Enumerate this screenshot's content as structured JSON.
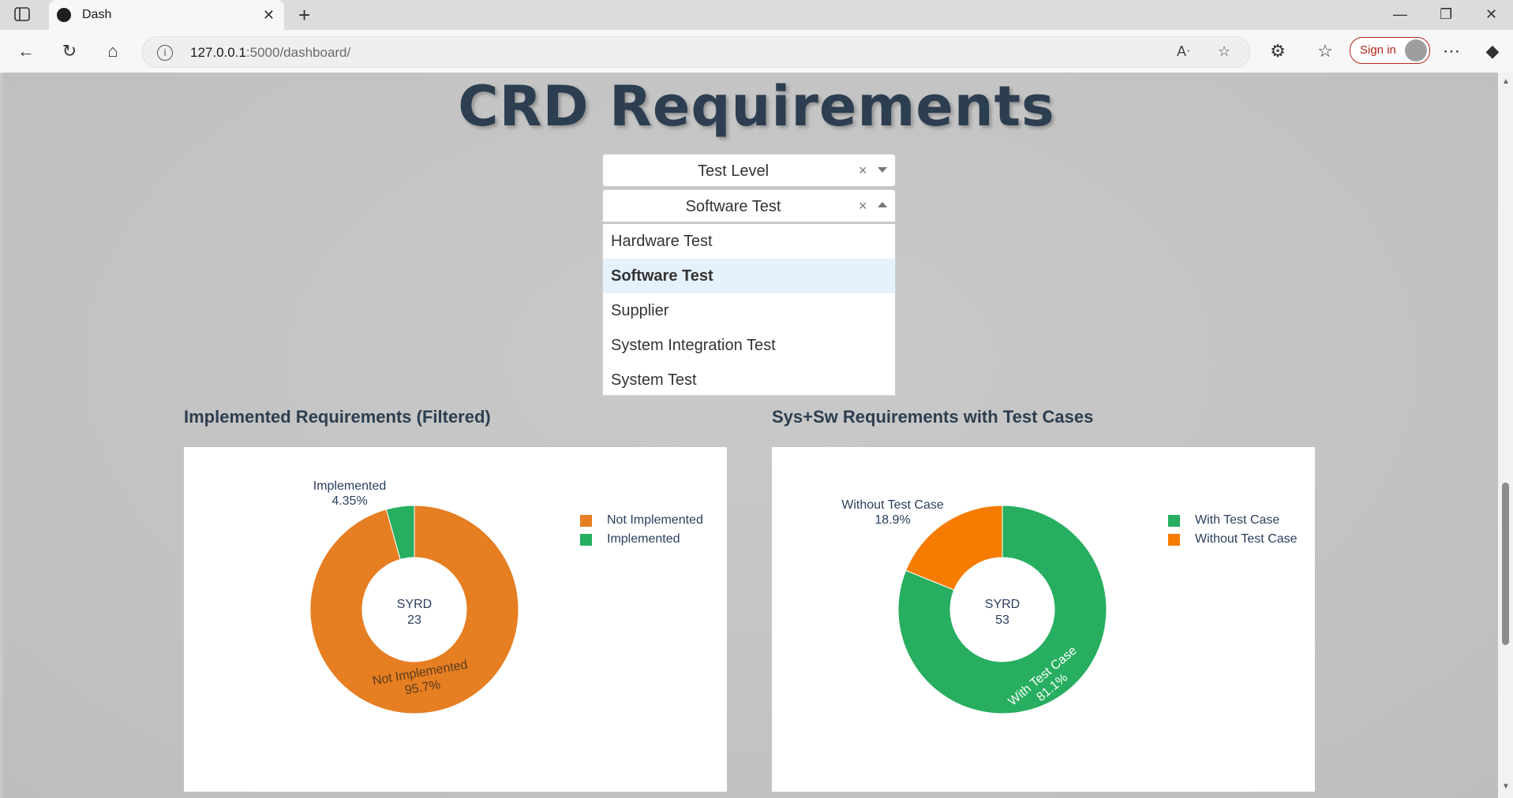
{
  "browser": {
    "tab_title": "Dash",
    "url_host": "127.0.0.1",
    "url_path": ":5000/dashboard/",
    "signin_label": "Sign in"
  },
  "page": {
    "title": "CRD Requirements"
  },
  "filters": {
    "test_level": {
      "value": "Test Level"
    },
    "test_type": {
      "value": "Software Test",
      "options": [
        "Hardware Test",
        "Software Test",
        "Supplier",
        "System Integration Test",
        "System Test"
      ],
      "selected_index": 1
    }
  },
  "colors": {
    "orange_dark": "#e67e22",
    "orange": "#f57c00",
    "green": "#27ae60"
  },
  "chart_data": [
    {
      "type": "pie",
      "title": "Implemented Requirements (Filtered)",
      "hole_label": "SYRD",
      "hole_value": "23",
      "labels": [
        "Not Implemented",
        "Implemented"
      ],
      "values": [
        22,
        1
      ],
      "percent_text": [
        "95.7%",
        "4.35%"
      ],
      "colors": [
        "#e67e22",
        "#27ae60"
      ],
      "legend": [
        "Not Implemented",
        "Implemented"
      ],
      "legend_position": "top-right"
    },
    {
      "type": "pie",
      "title": "Sys+Sw Requirements with Test Cases",
      "hole_label": "SYRD",
      "hole_value": "53",
      "labels": [
        "With Test Case",
        "Without Test Case"
      ],
      "values": [
        43,
        10
      ],
      "percent_text": [
        "81.1%",
        "18.9%"
      ],
      "colors": [
        "#27ae60",
        "#f57c00"
      ],
      "legend": [
        "With Test Case",
        "Without Test Case"
      ],
      "legend_position": "top-right"
    }
  ]
}
